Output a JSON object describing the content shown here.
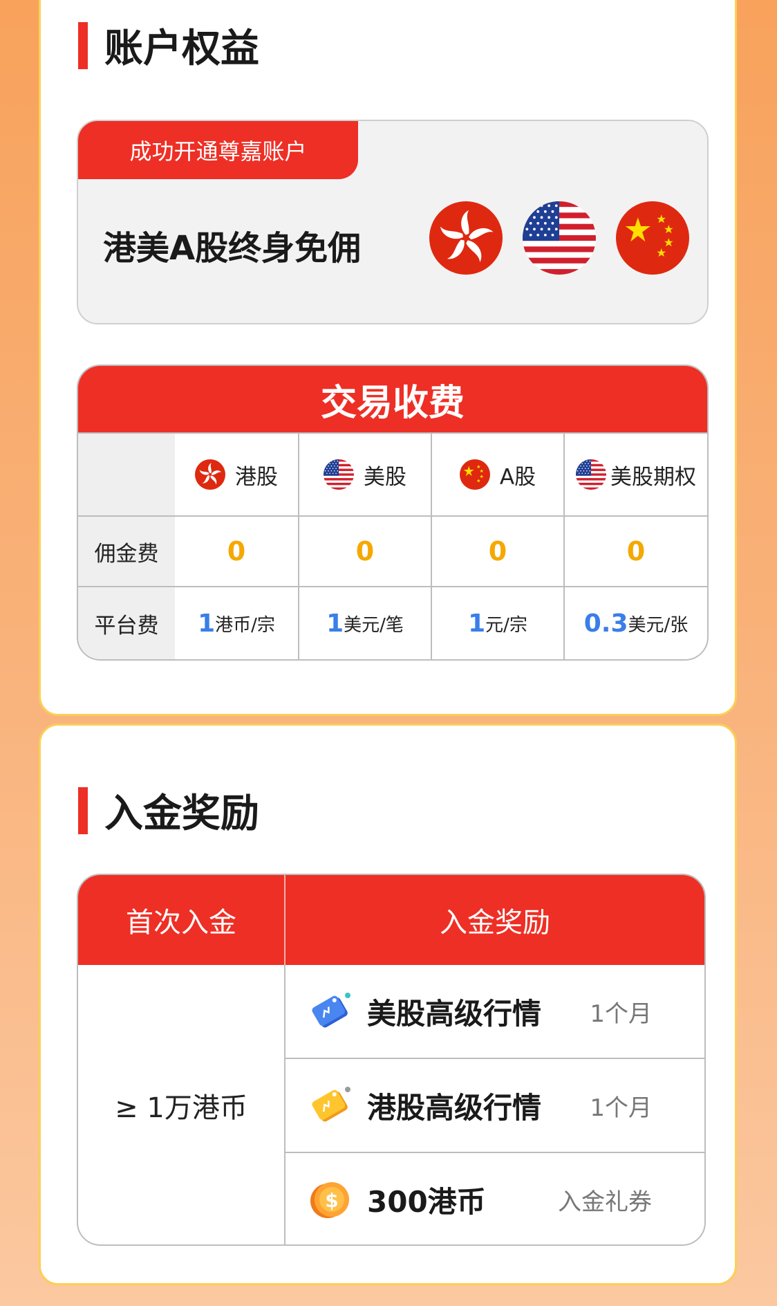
{
  "account_section": {
    "title": "账户权益",
    "tag": "成功开通尊嘉账户",
    "headline": "港美A股终身免佣",
    "flags": [
      "hong-kong-flag-icon",
      "us-flag-icon",
      "china-flag-icon"
    ]
  },
  "fee_section": {
    "title": "交易收费",
    "columns": [
      {
        "label": "港股",
        "icon": "hong-kong-flag-icon"
      },
      {
        "label": "美股",
        "icon": "us-flag-icon"
      },
      {
        "label": "A股",
        "icon": "china-flag-icon"
      },
      {
        "label": "美股期权",
        "icon": "us-flag-icon"
      }
    ],
    "rows": [
      {
        "label": "佣金费",
        "cells": [
          {
            "num": "0"
          },
          {
            "num": "0"
          },
          {
            "num": "0"
          },
          {
            "num": "0"
          }
        ]
      },
      {
        "label": "平台费",
        "cells": [
          {
            "num": "1",
            "unit": "港币/宗"
          },
          {
            "num": "1",
            "unit": "美元/笔"
          },
          {
            "num": "1",
            "unit": "元/宗"
          },
          {
            "num": "0.3",
            "unit": "美元/张"
          }
        ]
      }
    ]
  },
  "deposit_section": {
    "title": "入金奖励",
    "col1_header": "首次入金",
    "col2_header": "入金奖励",
    "threshold": "≥ 1万港币",
    "rewards": [
      {
        "name": "美股高级行情",
        "detail": "1个月",
        "icon": "blue-tag-icon"
      },
      {
        "name": "港股高级行情",
        "detail": "1个月",
        "icon": "yellow-tag-icon"
      },
      {
        "name": "300港币",
        "detail": "入金礼券",
        "icon": "coin-icon"
      }
    ]
  },
  "colors": {
    "accent": "#ee2f25",
    "zero": "#f5a800",
    "price": "#3a7ee8",
    "border": "#fbcf55"
  }
}
